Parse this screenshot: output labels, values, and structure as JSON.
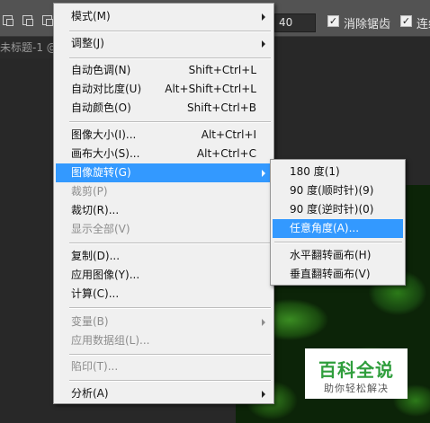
{
  "options_bar": {
    "feather_value": "40",
    "anti_alias_label": "消除锯齿",
    "anti_alias_checked": "✓",
    "contiguous_label": "连续",
    "contiguous_checked": "✓"
  },
  "document": {
    "tab_title": "未标题-1 @"
  },
  "watermark": {
    "title": "百科全说",
    "subtitle": "助你轻松解决"
  },
  "menu": {
    "items": [
      {
        "label": "模式(M)",
        "shortcut": ""
      },
      {
        "label": "调整(J)",
        "shortcut": ""
      },
      {
        "label": "自动色调(N)",
        "shortcut": "Shift+Ctrl+L"
      },
      {
        "label": "自动对比度(U)",
        "shortcut": "Alt+Shift+Ctrl+L"
      },
      {
        "label": "自动颜色(O)",
        "shortcut": "Shift+Ctrl+B"
      },
      {
        "label": "图像大小(I)...",
        "shortcut": "Alt+Ctrl+I"
      },
      {
        "label": "画布大小(S)...",
        "shortcut": "Alt+Ctrl+C"
      },
      {
        "label": "图像旋转(G)",
        "shortcut": ""
      },
      {
        "label": "裁剪(P)",
        "shortcut": ""
      },
      {
        "label": "裁切(R)...",
        "shortcut": ""
      },
      {
        "label": "显示全部(V)",
        "shortcut": ""
      },
      {
        "label": "复制(D)...",
        "shortcut": ""
      },
      {
        "label": "应用图像(Y)...",
        "shortcut": ""
      },
      {
        "label": "计算(C)...",
        "shortcut": ""
      },
      {
        "label": "变量(B)",
        "shortcut": ""
      },
      {
        "label": "应用数据组(L)...",
        "shortcut": ""
      },
      {
        "label": "陷印(T)...",
        "shortcut": ""
      },
      {
        "label": "分析(A)",
        "shortcut": ""
      }
    ]
  },
  "submenu": {
    "items": [
      {
        "label": "180 度(1)"
      },
      {
        "label": "90 度(顺时针)(9)"
      },
      {
        "label": "90 度(逆时针)(0)"
      },
      {
        "label": "任意角度(A)..."
      },
      {
        "label": "水平翻转画布(H)"
      },
      {
        "label": "垂直翻转画布(V)"
      }
    ]
  },
  "colors": {
    "highlight": "#3399ff",
    "menu_bg": "#f0f0f0",
    "disabled_text": "#8d8d8d"
  }
}
